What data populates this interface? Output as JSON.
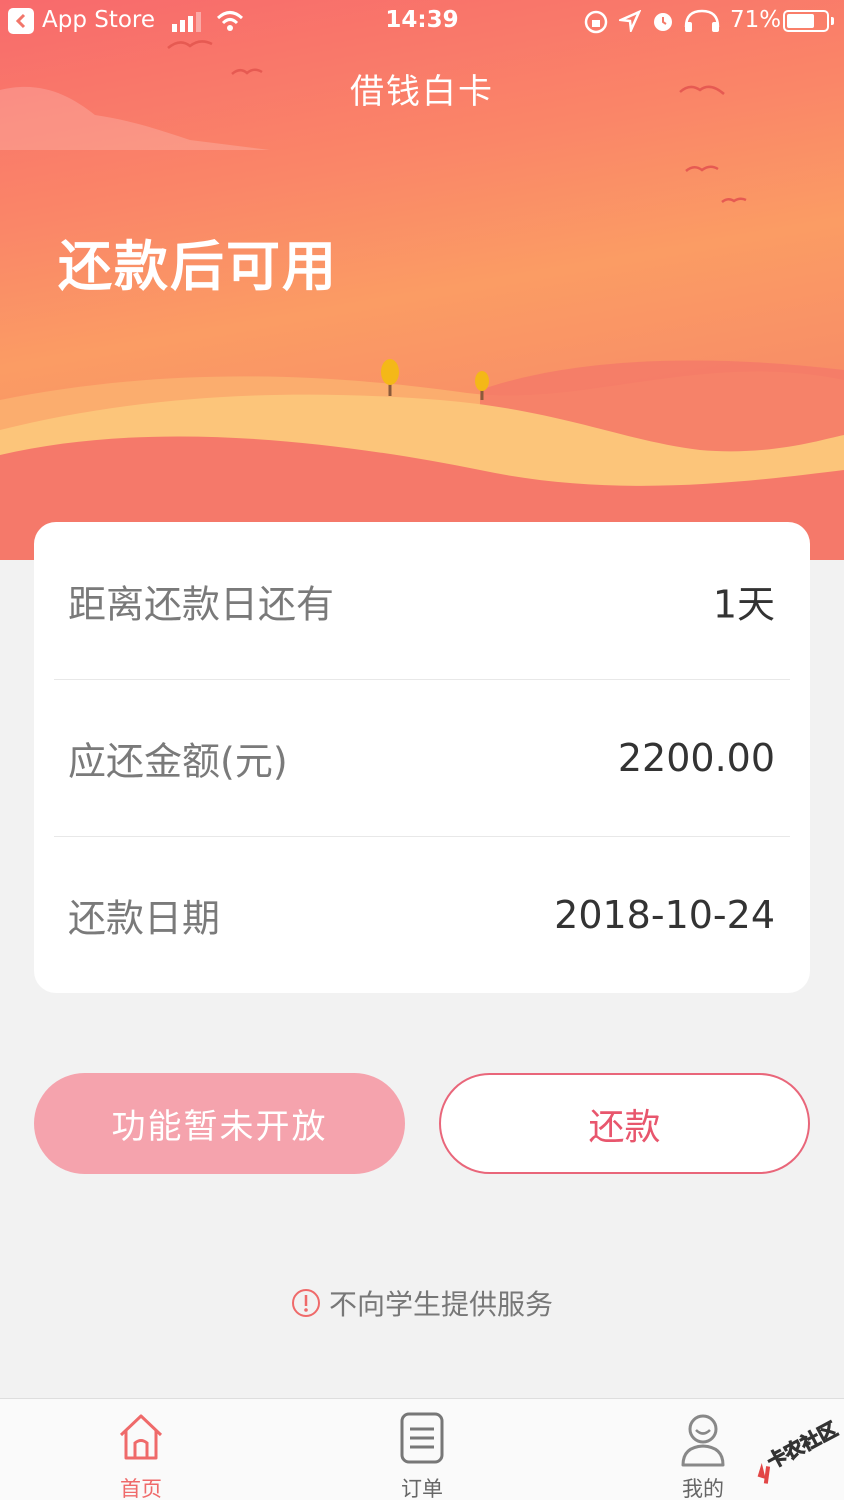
{
  "status_bar": {
    "back_app": "App Store",
    "time": "14:39",
    "battery": "71%",
    "battery_level": 0.71
  },
  "nav": {
    "title": "借钱白卡"
  },
  "hero": {
    "status": "还款后可用"
  },
  "card": {
    "rows": [
      {
        "label": "距离还款日还有",
        "value": "1天"
      },
      {
        "label": "应还金额(元)",
        "value": "2200.00"
      },
      {
        "label": "还款日期",
        "value": "2018-10-24"
      }
    ]
  },
  "buttons": {
    "disabled_label": "功能暂未开放",
    "repay_label": "还款"
  },
  "notice": {
    "text": "不向学生提供服务"
  },
  "tabbar": {
    "items": [
      {
        "label": "首页",
        "icon": "home-icon",
        "active": true
      },
      {
        "label": "订单",
        "icon": "order-icon",
        "active": false
      },
      {
        "label": "我的",
        "icon": "profile-icon",
        "active": false
      }
    ]
  },
  "watermark": {
    "text": "卡农社区"
  },
  "colors": {
    "accent": "#ef6a6a",
    "hero_top": "#f86a6c",
    "hero_mid": "#fb9c64",
    "disabled_button": "#f5a3ad",
    "repay_border": "#e9667a"
  }
}
